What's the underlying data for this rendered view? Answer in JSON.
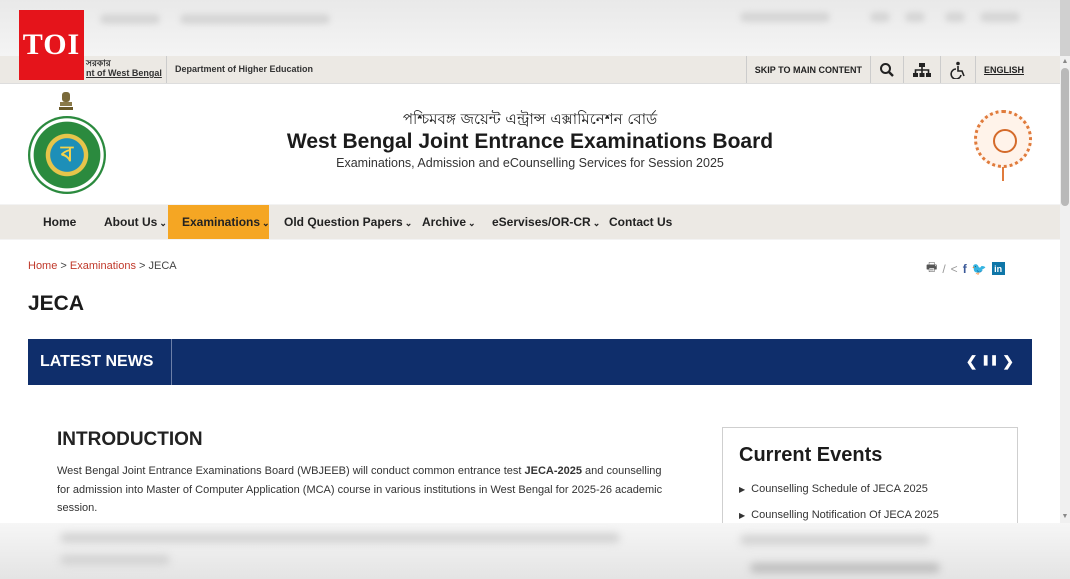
{
  "overlay": {
    "badge": "TOI"
  },
  "topbar": {
    "gov_line1": "সরকার",
    "gov_line2": "nt of West Bengal",
    "dept": "Department of Higher Education",
    "skip": "SKIP TO MAIN CONTENT",
    "language": "ENGLISH",
    "icons": [
      "search-icon",
      "sitemap-icon",
      "accessibility-icon"
    ]
  },
  "header": {
    "bengali_title": "পশ্চিমবঙ্গ জয়েন্ট এন্ট্রান্স এক্সামিনেশন বোর্ড",
    "title": "West Bengal Joint Entrance Examinations Board",
    "subtitle": "Examinations, Admission and eCounselling Services for Session 2025",
    "seal_glyph": "ব"
  },
  "nav": {
    "items": [
      {
        "label": "Home"
      },
      {
        "label": "About Us"
      },
      {
        "label": "Examinations"
      },
      {
        "label": "Old Question Papers"
      },
      {
        "label": "Archive"
      },
      {
        "label": "eServises/OR-CR"
      },
      {
        "label": "Contact Us"
      }
    ],
    "active": "Examinations",
    "accent": "#f5a623"
  },
  "breadcrumb": {
    "home": "Home",
    "sep": ">",
    "section": "Examinations",
    "current": "JECA"
  },
  "share": {
    "print": "🖶",
    "slash": "/",
    "share": "<",
    "fb": "f",
    "tw": "🐦",
    "li": "in"
  },
  "page": {
    "title": "JECA"
  },
  "latest_news": {
    "label": "LATEST NEWS",
    "controls": [
      "❮",
      "❚❚",
      "❯"
    ],
    "bg": "#0f2e6b"
  },
  "intro": {
    "heading": "INTRODUCTION",
    "text_before": "West Bengal Joint Entrance Examinations Board (WBJEEB) will conduct common entrance test ",
    "bold": "JECA-2025",
    "text_after": " and counselling for admission into Master of Computer Application (MCA) course in various institutions in West Bengal for 2025-26 academic session."
  },
  "events": {
    "heading": "Current Events",
    "items": [
      "Counselling Schedule of JECA 2025",
      "Counselling Notification Of JECA 2025"
    ]
  }
}
